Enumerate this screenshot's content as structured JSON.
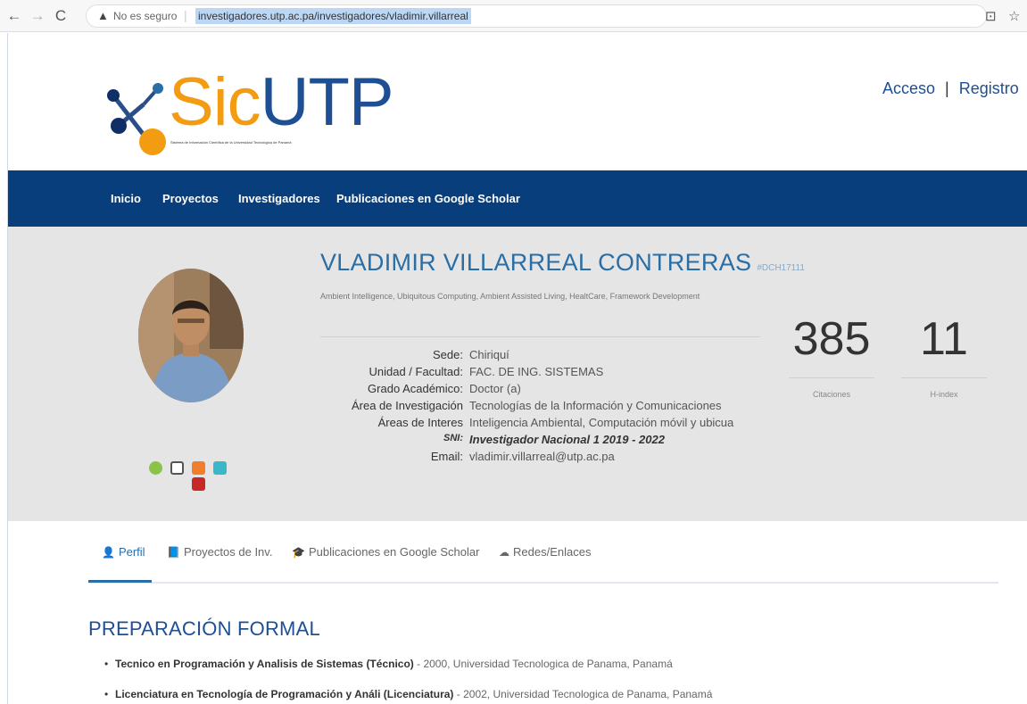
{
  "browser": {
    "back": "←",
    "forward": "→",
    "reload": "C",
    "security_label": "No es seguro",
    "url": "investigadores.utp.ac.pa/investigadores/vladimir.villarreal"
  },
  "header": {
    "logo_sic": "Sic",
    "logo_utp": "UTP",
    "logo_subtitle": "Sistema de Información Científica de la Universidad Tecnológica de Panamá",
    "login": "Acceso",
    "separator": "|",
    "register": "Registro"
  },
  "nav": {
    "items": [
      "Inicio",
      "Proyectos",
      "Investigadores",
      "Publicaciones en Google Scholar"
    ]
  },
  "profile": {
    "name": "VLADIMIR VILLARREAL CONTRERAS",
    "code": "#DCH17111",
    "interests": "Ambient Intelligence, Ubiquitous Computing, Ambient Assisted Living, HealtCare, Framework Development",
    "citations": "385",
    "citations_label": "Citaciones",
    "hindex": "11",
    "hindex_label": "H-index",
    "fields": [
      {
        "label": "Sede:",
        "value": "Chiriquí"
      },
      {
        "label": "Unidad / Facultad:",
        "value": "FAC. DE ING. SISTEMAS"
      },
      {
        "label": "Grado Académico:",
        "value": "Doctor (a)"
      },
      {
        "label": "Área de Investigación",
        "value": "Tecnologías de la Información y Comunicaciones"
      },
      {
        "label": "Áreas de Interes",
        "value": "Inteligencia Ambiental, Computación móvil y ubicua"
      },
      {
        "label": "SNI:",
        "value": "Investigador Nacional 1 2019 - 2022"
      },
      {
        "label": "Email:",
        "value": "vladimir.villarreal@utp.ac.pa"
      }
    ]
  },
  "tabs": [
    {
      "icon": "user-icon",
      "glyph": "👤",
      "label": "Perfil"
    },
    {
      "icon": "book-icon",
      "glyph": "📘",
      "label": "Proyectos de Inv."
    },
    {
      "icon": "graduation-cap-icon",
      "glyph": "🎓",
      "label": "Publicaciones en Google Scholar"
    },
    {
      "icon": "cloud-icon",
      "glyph": "☁",
      "label": "Redes/Enlaces"
    }
  ],
  "content": {
    "section_title": "PREPARACIÓN FORMAL",
    "items": [
      {
        "title": "Tecnico en Programación y Analisis de Sistemas (Técnico)",
        "detail": " - 2000, Universidad Tecnologica de Panama, Panamá"
      },
      {
        "title": "Licenciatura en Tecnología de Programación y Análi (Licenciatura)",
        "detail": " - 2002, Universidad Tecnologica de Panama, Panamá"
      }
    ]
  },
  "colors": {
    "navbar": "#083e7c",
    "accent": "#2a6ea5",
    "logo_orange": "#f39c12",
    "logo_blue": "#1f4f93",
    "profile_bg": "#e5e5e5"
  }
}
